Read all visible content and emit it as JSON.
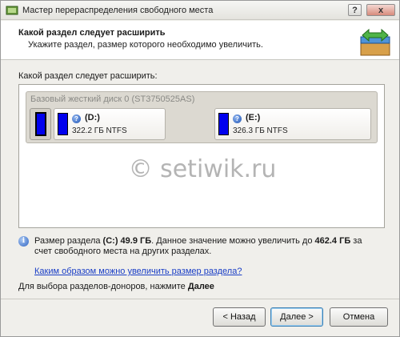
{
  "window": {
    "title": "Мастер перераспределения свободного места",
    "help_button": "?",
    "close_button": "x"
  },
  "header": {
    "title": "Какой раздел следует расширить",
    "subtitle": "Укажите раздел, размер которого необходимо увеличить."
  },
  "main": {
    "question": "Какой раздел следует расширить:",
    "disk": {
      "label": "Базовый жесткий диск 0 (ST3750525AS)",
      "partitions": [
        {
          "letter": "",
          "size": ""
        },
        {
          "letter": "(D:)",
          "size": "322.2 ГБ NTFS"
        },
        {
          "letter": "(E:)",
          "size": "326.3 ГБ NTFS"
        }
      ]
    },
    "watermark": "© setiwik.ru"
  },
  "info": {
    "prefix": "Размер раздела ",
    "partition": "(C:) 49.9 ГБ",
    "middle": ". Данное значение можно увеличить до ",
    "max": "462.4 ГБ",
    "suffix": " за счет свободного места на других разделах.",
    "link": "Каким образом можно увеличить размер раздела?",
    "hint_prefix": "Для выбора разделов-доноров, нажмите ",
    "hint_bold": "Далее"
  },
  "buttons": {
    "back": "< Назад",
    "next": "Далее >",
    "cancel": "Отмена"
  },
  "colors": {
    "partition_fill": "#0000ee",
    "link": "#1a3ec6"
  }
}
